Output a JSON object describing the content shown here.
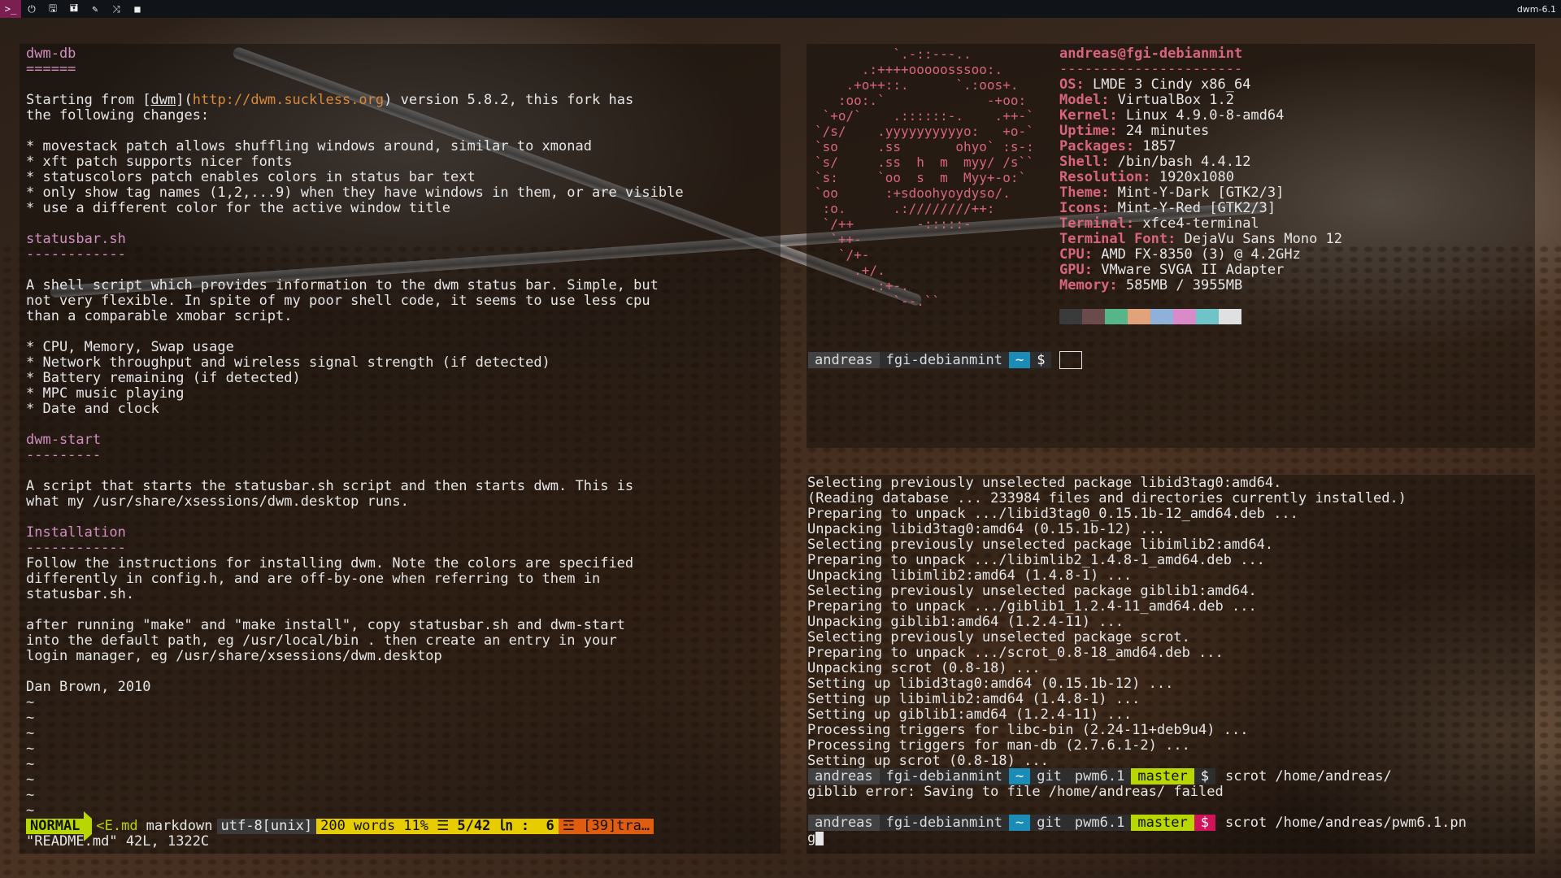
{
  "topbar": {
    "tags": [
      {
        "icon": "terminal-icon",
        "glyph": ">_",
        "active": true
      },
      {
        "icon": "power-icon",
        "glyph": "⏻",
        "active": false
      },
      {
        "icon": "save-icon",
        "glyph": "🖫",
        "active": false
      },
      {
        "icon": "save-alt-icon",
        "glyph": "🖬",
        "active": false
      },
      {
        "icon": "wrench-icon",
        "glyph": "✎",
        "active": false
      },
      {
        "icon": "shuffle-icon",
        "glyph": "⤨",
        "active": false
      },
      {
        "icon": "square-icon",
        "glyph": "■",
        "active": false
      }
    ],
    "title": "dwm-6.1"
  },
  "vim": {
    "lines": [
      {
        "text": "dwm-db",
        "style": "h"
      },
      {
        "text": "======",
        "style": "h"
      },
      {
        "text": "",
        "style": ""
      },
      {
        "parts": [
          {
            "text": "Starting from [",
            "style": ""
          },
          {
            "text": "dwm",
            "style": "u"
          },
          {
            "text": "](",
            "style": ""
          },
          {
            "text": "http://dwm.suckless.org",
            "style": "url"
          },
          {
            "text": ") version 5.8.2, this fork has",
            "style": ""
          }
        ]
      },
      {
        "text": "the following changes:",
        "style": ""
      },
      {
        "text": "",
        "style": ""
      },
      {
        "text": "* movestack patch allows shuffling windows around, similar to xmonad",
        "style": ""
      },
      {
        "text": "* xft patch supports nicer fonts",
        "style": ""
      },
      {
        "text": "* statuscolors patch enables colors in status bar text",
        "style": ""
      },
      {
        "text": "* only show tag names (1,2,...9) when they have windows in them, or are visible",
        "style": ""
      },
      {
        "text": "* use a different color for the active window title",
        "style": ""
      },
      {
        "text": "",
        "style": ""
      },
      {
        "text": "statusbar.sh",
        "style": "h"
      },
      {
        "text": "------------",
        "style": "h"
      },
      {
        "text": "",
        "style": ""
      },
      {
        "text": "A shell script which provides information to the dwm status bar. Simple, but",
        "style": ""
      },
      {
        "text": "not very flexible. In spite of my poor shell code, it seems to use less cpu",
        "style": ""
      },
      {
        "text": "than a comparable xmobar script.",
        "style": ""
      },
      {
        "text": "",
        "style": ""
      },
      {
        "text": "* CPU, Memory, Swap usage",
        "style": ""
      },
      {
        "text": "* Network throughput and wireless signal strength (if detected)",
        "style": ""
      },
      {
        "text": "* Battery remaining (if detected)",
        "style": ""
      },
      {
        "text": "* MPC music playing",
        "style": ""
      },
      {
        "text": "* Date and clock",
        "style": ""
      },
      {
        "text": "",
        "style": ""
      },
      {
        "text": "dwm-start",
        "style": "h"
      },
      {
        "text": "---------",
        "style": "h"
      },
      {
        "text": "",
        "style": ""
      },
      {
        "text": "A script that starts the statusbar.sh script and then starts dwm. This is",
        "style": ""
      },
      {
        "text": "what my /usr/share/xsessions/dwm.desktop runs.",
        "style": ""
      },
      {
        "text": "",
        "style": ""
      },
      {
        "text": "Installation",
        "style": "h"
      },
      {
        "text": "------------",
        "style": "h"
      },
      {
        "text": "Follow the instructions for installing dwm. Note the colors are specified",
        "style": ""
      },
      {
        "text": "differently in config.h, and are off-by-one when referring to them in",
        "style": ""
      },
      {
        "text": "statusbar.sh.",
        "style": ""
      },
      {
        "text": "",
        "style": ""
      },
      {
        "text": "after running \"make\" and \"make install\", copy statusbar.sh and dwm-start",
        "style": ""
      },
      {
        "text": "into the default path, eg /usr/local/bin . then create an entry in your",
        "style": ""
      },
      {
        "text": "login manager, eg /usr/share/xsessions/dwm.desktop",
        "style": ""
      },
      {
        "text": "",
        "style": ""
      },
      {
        "text": "Dan Brown, 2010",
        "style": ""
      },
      {
        "text": "~",
        "style": "tilde"
      },
      {
        "text": "~",
        "style": "tilde"
      },
      {
        "text": "~",
        "style": "tilde"
      },
      {
        "text": "~",
        "style": "tilde"
      },
      {
        "text": "~",
        "style": "tilde"
      },
      {
        "text": "~",
        "style": "tilde"
      },
      {
        "text": "~",
        "style": "tilde"
      },
      {
        "text": "~",
        "style": "tilde"
      }
    ],
    "status": {
      "mode": "NORMAL",
      "file": "<E.md",
      "filetype": "markdown",
      "encoding": "utf-8[unix]",
      "words": "200 words",
      "percent": "11% ☰",
      "position": "5/42 ㏑ :  6",
      "warning": "☲ [39]tra…"
    },
    "cmdline": "\"README.md\" 42L, 1322C"
  },
  "neofetch": {
    "logo": [
      "          `.-::---..",
      "      .:++++ooooosssoo:.",
      "    .+o++::.      `.:oos+.",
      "   :oo:.`             -+oo:",
      " `+o/`    .::::::-.    .++-`",
      "`/s/    .yyyyyyyyyyo:   +o-`",
      "`so     .ss       ohyo` :s-:",
      "`s/     .ss  h  m  myy/ /s``",
      "`s:     `oo  s  m  Myy+-o:`",
      "`oo      :+sdoohyoydyso/.",
      " :o.      .:////////++:",
      " `/++        -:::::-",
      "  `++-",
      "   `/+-",
      "     .+/.",
      "       .:+-.",
      "          `--.``"
    ],
    "user": "andreas",
    "host": "fgi-debianmint",
    "separator": "----------------------",
    "fields": [
      {
        "key": "OS",
        "value": "LMDE 3 Cindy x86_64"
      },
      {
        "key": "Model",
        "value": "VirtualBox 1.2"
      },
      {
        "key": "Kernel",
        "value": "Linux 4.9.0-8-amd64"
      },
      {
        "key": "Uptime",
        "value": "24 minutes"
      },
      {
        "key": "Packages",
        "value": "1857"
      },
      {
        "key": "Shell",
        "value": "/bin/bash 4.4.12"
      },
      {
        "key": "Resolution",
        "value": "1920x1080"
      },
      {
        "key": "Theme",
        "value": "Mint-Y-Dark [GTK2/3]"
      },
      {
        "key": "Icons",
        "value": "Mint-Y-Red [GTK2/3]"
      },
      {
        "key": "Terminal",
        "value": "xfce4-terminal"
      },
      {
        "key": "Terminal Font",
        "value": "DejaVu Sans Mono 12"
      },
      {
        "key": "CPU",
        "value": "AMD FX-8350 (3) @ 4.2GHz"
      },
      {
        "key": "GPU",
        "value": "VMware SVGA II Adapter"
      },
      {
        "key": "Memory",
        "value": "585MB / 3955MB"
      }
    ],
    "swatches": [
      "#3a3a3a",
      "#6a4a4a",
      "#56b68a",
      "#e2a37a",
      "#8fb0d8",
      "#d88bc8",
      "#6fc4c8",
      "#e0e0e0"
    ]
  },
  "prompt_top": {
    "user": "andreas",
    "host": "fgi-debianmint",
    "dir": "~",
    "dollar": "$"
  },
  "apt": {
    "lines": [
      "Selecting previously unselected package libid3tag0:amd64.",
      "(Reading database ... 233984 files and directories currently installed.)",
      "Preparing to unpack .../libid3tag0_0.15.1b-12_amd64.deb ...",
      "Unpacking libid3tag0:amd64 (0.15.1b-12) ...",
      "Selecting previously unselected package libimlib2:amd64.",
      "Preparing to unpack .../libimlib2_1.4.8-1_amd64.deb ...",
      "Unpacking libimlib2:amd64 (1.4.8-1) ...",
      "Selecting previously unselected package giblib1:amd64.",
      "Preparing to unpack .../giblib1_1.2.4-11_amd64.deb ...",
      "Unpacking giblib1:amd64 (1.2.4-11) ...",
      "Selecting previously unselected package scrot.",
      "Preparing to unpack .../scrot_0.8-18_amd64.deb ...",
      "Unpacking scrot (0.8-18) ...",
      "Setting up libid3tag0:amd64 (0.15.1b-12) ...",
      "Setting up libimlib2:amd64 (1.4.8-1) ...",
      "Setting up giblib1:amd64 (1.2.4-11) ...",
      "Processing triggers for libc-bin (2.24-11+deb9u4) ...",
      "Processing triggers for man-db (2.7.6.1-2) ...",
      "Setting up scrot (0.8-18) ..."
    ],
    "prompt1": {
      "user": "andreas",
      "host": "fgi-debianmint",
      "dir": "~",
      "git": "git",
      "repo": "pwm6.1",
      "branch": "master",
      "dollar": "$",
      "command": "scrot /home/andreas/"
    },
    "error": "giblib error: Saving to file /home/andreas/ failed",
    "prompt2": {
      "user": "andreas",
      "host": "fgi-debianmint",
      "dir": "~",
      "git": "git",
      "repo": "pwm6.1",
      "branch": "master",
      "dollar": "$",
      "command": "scrot /home/andreas/pwm6.1.pn"
    },
    "wrap": "g"
  }
}
